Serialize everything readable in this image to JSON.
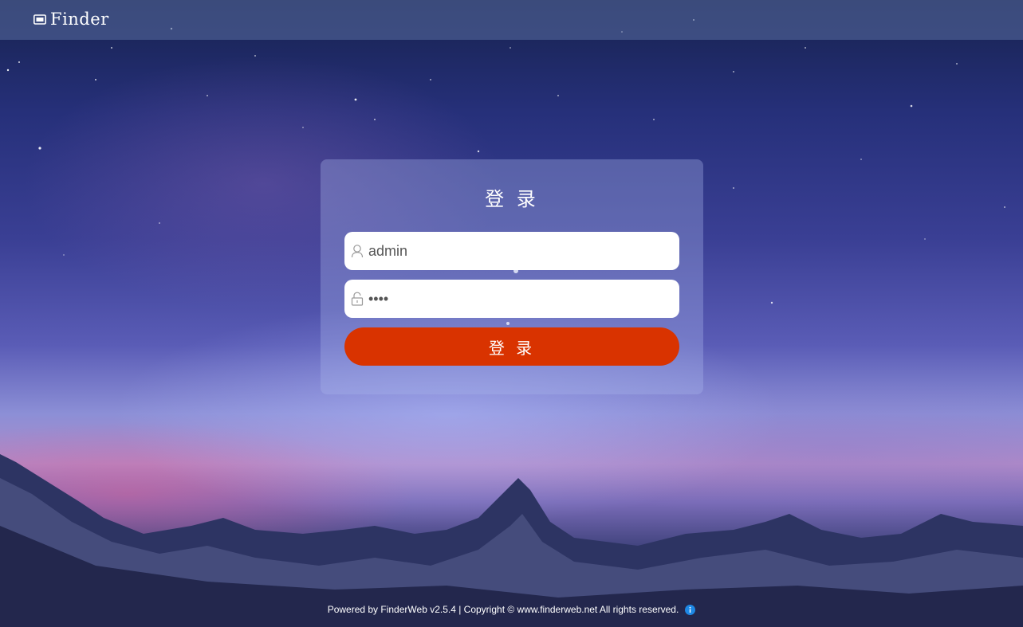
{
  "app": {
    "brand_name": "Finder",
    "brand_icon": "folder-icon"
  },
  "login": {
    "title": "登 录",
    "username": {
      "icon": "user-icon",
      "value": "admin"
    },
    "password": {
      "icon": "lock-icon",
      "value": "••••"
    },
    "submit_label": "登 录"
  },
  "footer": {
    "text": "Powered by FinderWeb v2.5.4 | Copyright © www.finderweb.net All rights reserved.",
    "info_icon": "info-icon"
  },
  "colors": {
    "button": "#d93300",
    "topbar": "#5a6ea0",
    "info": "#1e88e5"
  }
}
